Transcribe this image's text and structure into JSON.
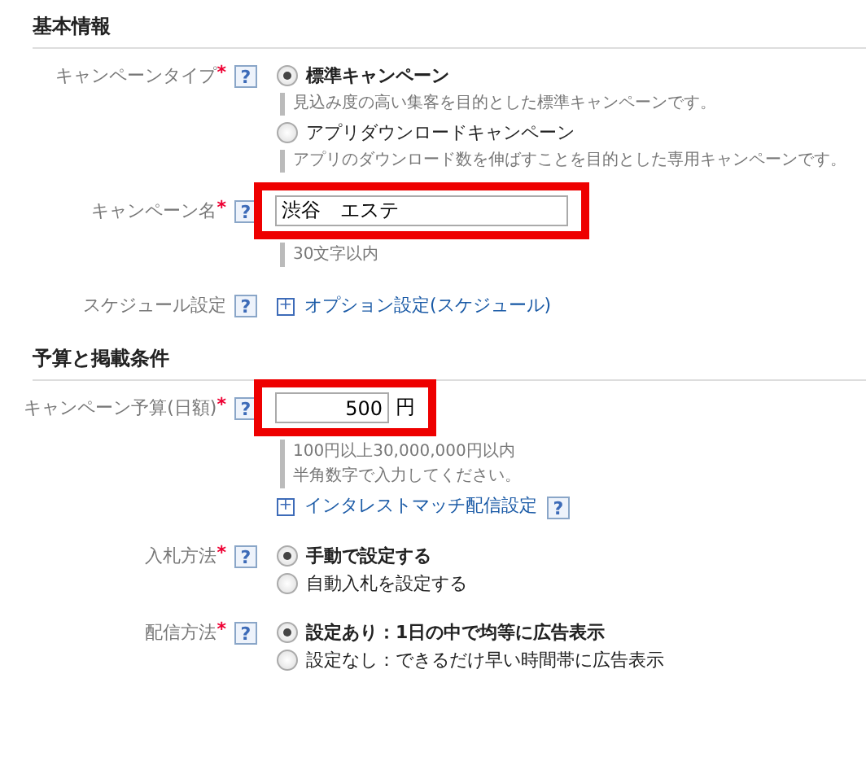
{
  "sections": [
    {
      "title": "基本情報",
      "fields": [
        {
          "kind": "radio",
          "label": "キャンペーンタイプ",
          "required_mark": "*",
          "help": "?",
          "options": [
            {
              "label": "標準キャンペーン",
              "selected": true,
              "description": "見込み度の高い集客を目的とした標準キャンペーンです。"
            },
            {
              "label": "アプリダウンロードキャンペーン",
              "selected": false,
              "description": "アプリのダウンロード数を伸ばすことを目的とした専用キャンペーンです。"
            }
          ]
        },
        {
          "kind": "text",
          "label": "キャンペーン名",
          "required_mark": "*",
          "help": "?",
          "value": "渋谷　エステ",
          "highlighted": true,
          "hints": [
            "30文字以内"
          ]
        },
        {
          "kind": "link",
          "label": "スケジュール設定",
          "help": "?",
          "link": {
            "toggle": "+",
            "text": "オプション設定(スケジュール)"
          }
        }
      ]
    },
    {
      "title": "予算と掲載条件",
      "fields": [
        {
          "kind": "money",
          "label": "キャンペーン予算(日額)",
          "required_mark": "*",
          "help": "?",
          "value": "500",
          "unit": "円",
          "highlighted": true,
          "hints": [
            "100円以上30,000,000円以内",
            "半角数字で入力してください。"
          ],
          "link": {
            "toggle": "+",
            "text": "インタレストマッチ配信設定",
            "help": "?"
          }
        },
        {
          "kind": "radio",
          "label": "入札方法",
          "required_mark": "*",
          "help": "?",
          "options": [
            {
              "label": "手動で設定する",
              "selected": true
            },
            {
              "label": "自動入札を設定する",
              "selected": false
            }
          ]
        },
        {
          "kind": "radio",
          "label": "配信方法",
          "required_mark": "*",
          "help": "?",
          "options": [
            {
              "label": "設定あり：1日の中で均等に広告表示",
              "selected": true
            },
            {
              "label": "設定なし：できるだけ早い時間帯に広告表示",
              "selected": false
            }
          ]
        }
      ]
    }
  ]
}
